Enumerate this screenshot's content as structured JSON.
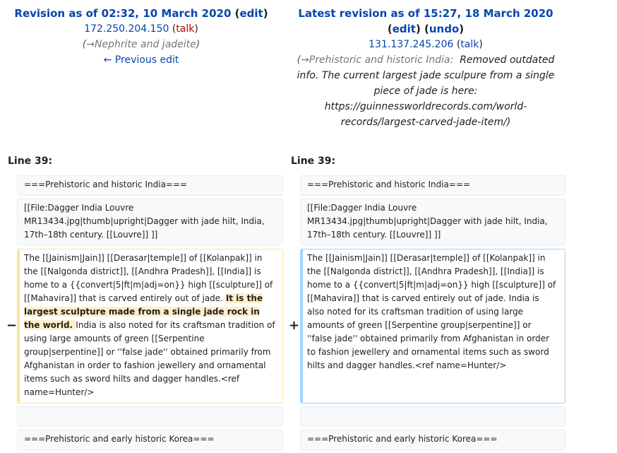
{
  "left_header": {
    "title": "Revision as of 02:32, 10 March 2020",
    "edit": "edit",
    "user": "172.250.204.150",
    "talk": "talk",
    "summary_arrow": "→",
    "summary": "Nephrite and jadeite",
    "prev": "← Previous edit"
  },
  "right_header": {
    "title": "Latest revision as of 15:27, 18 March 2020",
    "edit": "edit",
    "undo": "undo",
    "user": "131.137.245.206",
    "talk": "talk",
    "summary_section": "→Prehistoric and historic India:",
    "summary": "Removed outdated info. The current largest jade sculpure from a single piece of jade is here: https://guinnessworldrecords.com/world-records/largest-carved-jade-item/)"
  },
  "diff": {
    "line_left": "Line 39:",
    "line_right": "Line 39:",
    "row1": "===Prehistoric and historic India===",
    "row2": "[[File:Dagger India Louvre MR13434.jpg|thumb|upright|Dagger with jade hilt, India, 17th–18th century. [[Louvre]] ]]",
    "left_pre": "The [[Jainism|Jain]] [[Derasar|temple]] of [[Kolanpak]] in the [[Nalgonda district]], [[Andhra Pradesh]], [[India]] is home to a {{convert|5|ft|m|adj=on}} high [[sculpture]] of [[Mahavira]] that is carved entirely out of jade. ",
    "left_hl": "It is the largest sculpture made from a single jade rock in the world. ",
    "left_post": " India is also noted for its craftsman tradition of using large amounts of green [[Serpentine group|serpentine]] or ''false jade'' obtained primarily from Afghanistan in order to fashion jewellery and ornamental items such as sword hilts and dagger handles.<ref name=Hunter/>",
    "right_text": "The [[Jainism|Jain]] [[Derasar|temple]] of [[Kolanpak]] in the [[Nalgonda district]], [[Andhra Pradesh]], [[India]] is home to a {{convert|5|ft|m|adj=on}} high [[sculpture]] of [[Mahavira]] that is carved entirely out of jade. India is also noted for its craftsman tradition of using large amounts of green [[Serpentine group|serpentine]] or ''false jade'' obtained primarily from Afghanistan in order to fashion jewellery and ornamental items such as sword hilts and dagger handles.<ref name=Hunter/>",
    "row5": "",
    "row6": "===Prehistoric and early historic Korea===",
    "minus": "−",
    "plus": "+"
  }
}
